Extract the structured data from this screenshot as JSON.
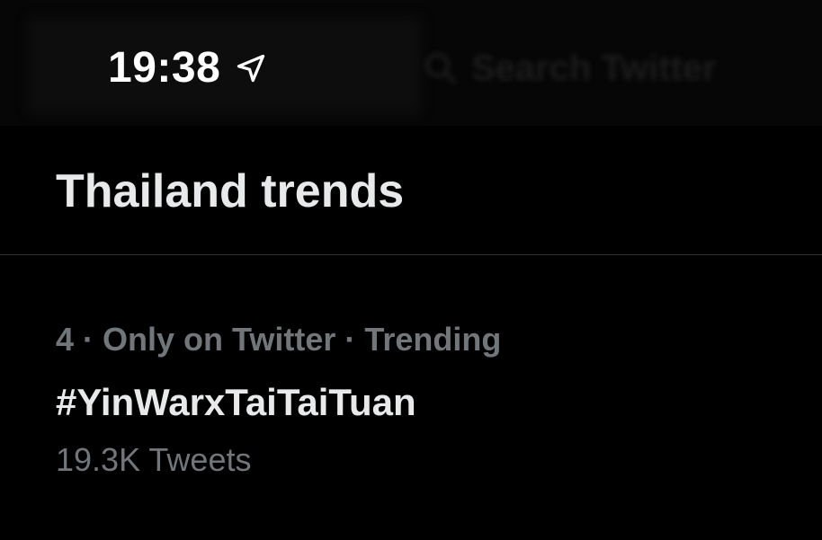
{
  "status_bar": {
    "time": "19:38",
    "location_icon": "location-arrow-icon",
    "background_search_hint": "Search Twitter"
  },
  "section": {
    "title": "Thailand trends"
  },
  "trends": [
    {
      "rank": "4",
      "context": "Only on Twitter",
      "status": "Trending",
      "meta": "4 · Only on Twitter · Trending",
      "name": "#YinWarxTaiTaiTuan",
      "tweet_count": "19.3K Tweets"
    }
  ],
  "colors": {
    "background": "#000000",
    "primary_text": "#e7e9ea",
    "secondary_text": "#71767b",
    "divider": "#2f3336"
  }
}
